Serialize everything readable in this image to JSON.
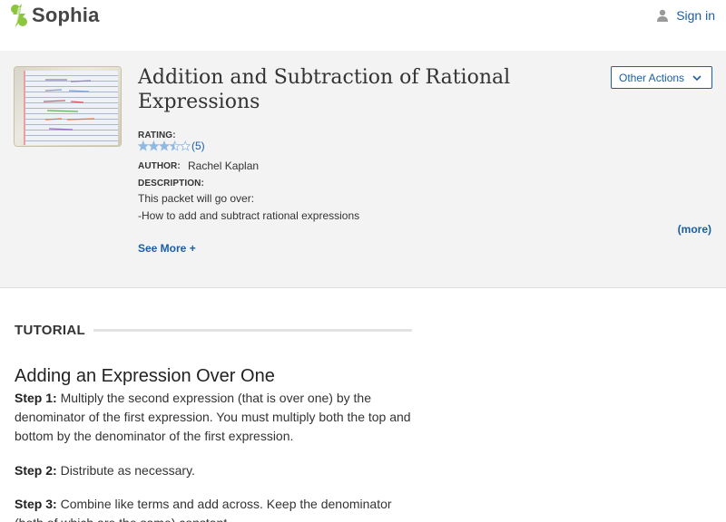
{
  "brand": {
    "name": "Sophia",
    "icon": "sophia-logo-icon",
    "color": "#8cc63f"
  },
  "header": {
    "signin_label": "Sign in",
    "signin_icon": "person-icon"
  },
  "content": {
    "title": "Addition and Subtraction of Rational Expressions",
    "thumbnail_icon": "notebook-thumbnail",
    "other_actions_label": "Other Actions",
    "rating_label": "RATING:",
    "rating_stars": 3.5,
    "rating_max": 5,
    "rating_count": "(5)",
    "author_label": "AUTHOR:",
    "author_name": "Rachel Kaplan",
    "description_label": "DESCRIPTION:",
    "description_lines": [
      "This packet will go over:",
      "-How to add and subtract rational expressions"
    ],
    "more_label": "(more)",
    "see_more_label": "See More +"
  },
  "tutorial": {
    "section_label": "TUTORIAL",
    "heading": "Adding an Expression Over One",
    "steps": [
      {
        "label": "Step 1:",
        "text": " Multiply the second expression (that is over one) by the denominator of the first expression. You must multiply both the top and bottom by the denominator of the first expression."
      },
      {
        "label": "Step 2:",
        "text": "  Distribute as necessary."
      },
      {
        "label": "Step 3:",
        "text": " Combine like terms and add across. Keep the denominator (both of which are the same) constant."
      }
    ]
  },
  "colors": {
    "accent": "#1b5ea8",
    "star": "#8fb8e3",
    "panel_bg": "#f3f3f3"
  }
}
